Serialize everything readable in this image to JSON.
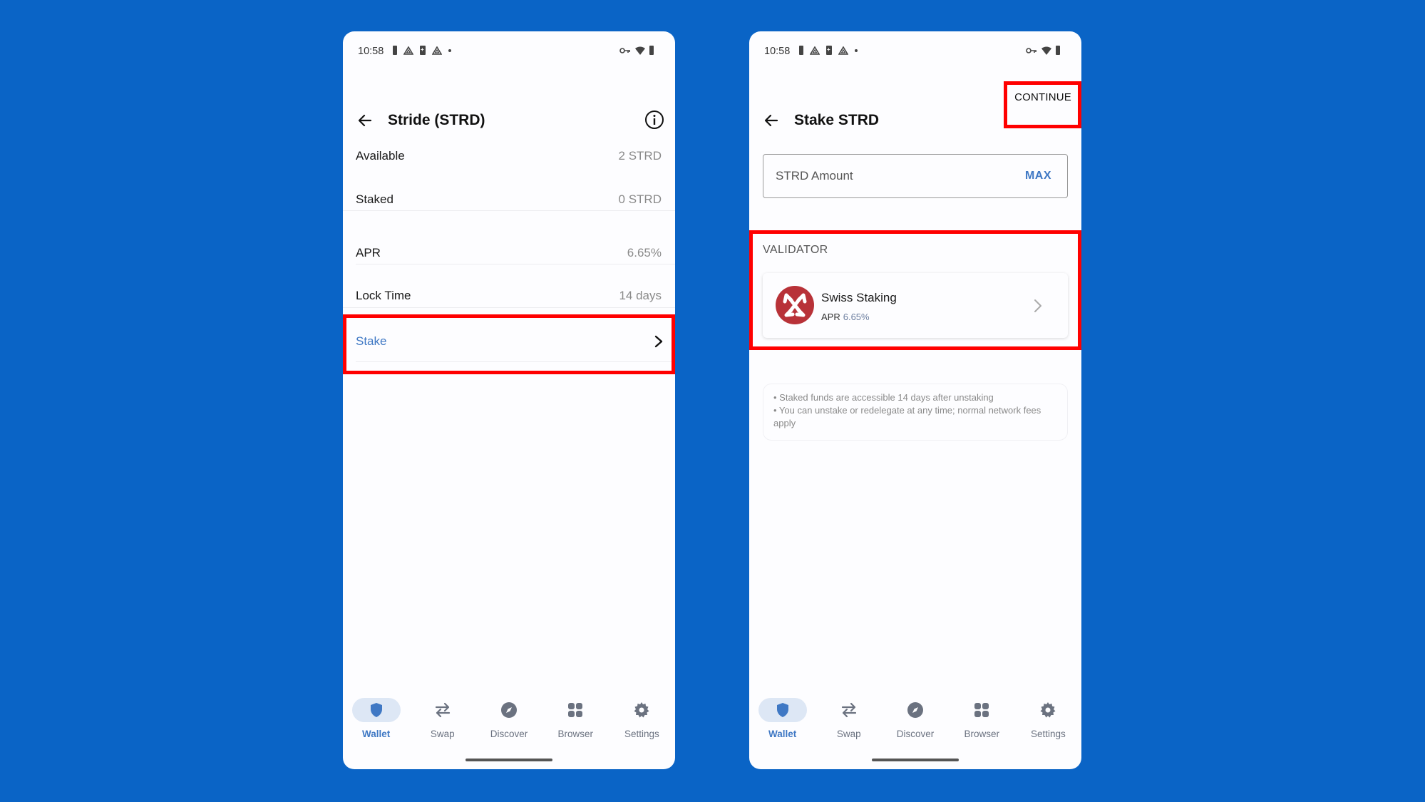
{
  "colors": {
    "background": "#0a64c6",
    "accent": "#3f78c4",
    "highlight": "#ff0000",
    "validator_logo": "#b83238"
  },
  "status_bar": {
    "time": "10:58"
  },
  "left_screen": {
    "title": "Stride (STRD)",
    "back_icon": "arrow-left-icon",
    "info_icon": "info-icon",
    "rows": [
      {
        "label": "Available",
        "value": "2 STRD"
      },
      {
        "label": "Staked",
        "value": "0 STRD"
      },
      {
        "label": "APR",
        "value": "6.65%"
      },
      {
        "label": "Lock Time",
        "value": "14 days"
      }
    ],
    "stake_label": "Stake"
  },
  "right_screen": {
    "title": "Stake STRD",
    "back_icon": "arrow-left-icon",
    "continue_label": "CONTINUE",
    "amount_placeholder": "STRD Amount",
    "max_label": "MAX",
    "validator_section_label": "VALIDATOR",
    "validator": {
      "name": "Swiss Staking",
      "apr_label": "APR",
      "apr_value": "6.65%"
    },
    "notes": [
      "• Staked funds are accessible 14 days after unstaking",
      "• You can unstake or redelegate at any time; normal network fees apply"
    ]
  },
  "bottom_nav": {
    "items": [
      {
        "label": "Wallet",
        "icon": "shield-icon",
        "active": true
      },
      {
        "label": "Swap",
        "icon": "swap-arrows-icon",
        "active": false
      },
      {
        "label": "Discover",
        "icon": "compass-icon",
        "active": false
      },
      {
        "label": "Browser",
        "icon": "grid-icon",
        "active": false
      },
      {
        "label": "Settings",
        "icon": "gear-icon",
        "active": false
      }
    ]
  }
}
